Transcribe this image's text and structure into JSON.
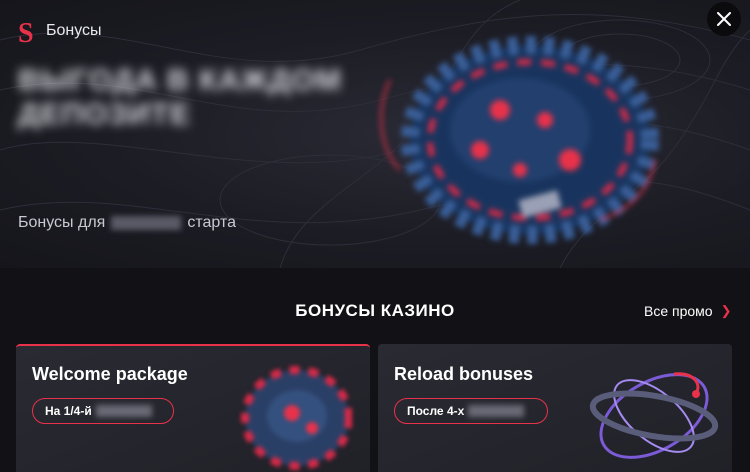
{
  "header": {
    "brand_title": "Бонусы",
    "logo_letter": "S",
    "headline": "Выгода в каждом депозите",
    "subline_prefix": "Бонусы для",
    "subline_suffix": "старта",
    "close_icon": "close-icon"
  },
  "section": {
    "title": "БОНУСЫ КАЗИНО",
    "all_promo_label": "Все промо",
    "all_promo_icon": "chevron-right-icon"
  },
  "cards": [
    {
      "title": "Welcome package",
      "badge": "На 1/4-й"
    },
    {
      "title": "Reload bonuses",
      "badge": "После 4-х"
    }
  ],
  "colors": {
    "accent": "#e8324a",
    "background": "#121216",
    "card": "#25252d"
  }
}
